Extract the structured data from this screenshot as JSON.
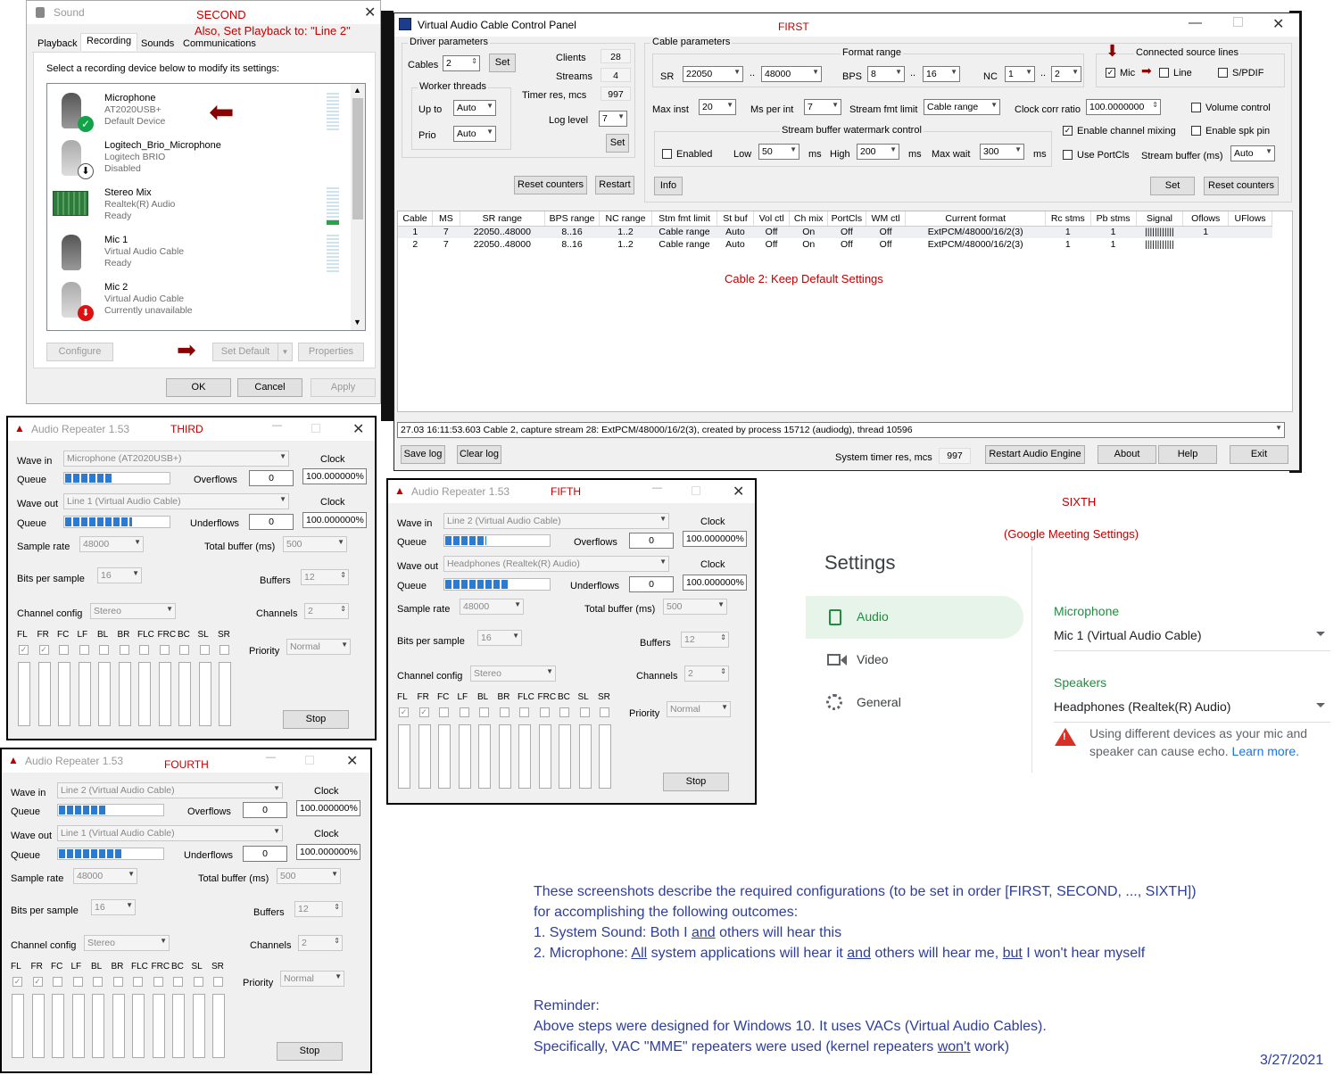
{
  "sound": {
    "title": "Sound",
    "tag": "SECOND",
    "tag2": "Also, Set Playback to:  \"Line 2\"",
    "tabs": [
      "Playback",
      "Recording",
      "Sounds",
      "Communications"
    ],
    "instruction": "Select a recording device below to modify its settings:",
    "devices": [
      {
        "name": "Microphone",
        "sub1": "AT2020USB+",
        "sub2": "Default Device"
      },
      {
        "name": "Logitech_Brio_Microphone",
        "sub1": "Logitech BRIO",
        "sub2": "Disabled"
      },
      {
        "name": "Stereo Mix",
        "sub1": "Realtek(R) Audio",
        "sub2": "Ready"
      },
      {
        "name": "Mic 1",
        "sub1": "Virtual Audio Cable",
        "sub2": "Ready"
      },
      {
        "name": "Mic 2",
        "sub1": "Virtual Audio Cable",
        "sub2": "Currently unavailable"
      }
    ],
    "configure": "Configure",
    "set_default": "Set Default",
    "properties": "Properties",
    "ok": "OK",
    "cancel": "Cancel",
    "apply": "Apply"
  },
  "vac": {
    "title": "Virtual Audio Cable Control Panel",
    "tag": "FIRST",
    "driver_params": "Driver parameters",
    "cables_lbl": "Cables",
    "cables_val": "2",
    "set": "Set",
    "clients_lbl": "Clients",
    "clients_val": "28",
    "streams_lbl": "Streams",
    "streams_val": "4",
    "timer_lbl": "Timer res, mcs",
    "timer_val": "997",
    "worker": "Worker threads",
    "upto_lbl": "Up to",
    "upto_val": "Auto",
    "prio_lbl": "Prio",
    "prio_val": "Auto",
    "loglevel_lbl": "Log level",
    "loglevel_val": "7",
    "reset_counters": "Reset counters",
    "restart": "Restart",
    "cable_params": "Cable parameters",
    "format_range": "Format range",
    "sr_lbl": "SR",
    "sr_from": "22050",
    "sr_to": "48000",
    "dots": "..",
    "bps_lbl": "BPS",
    "bps_from": "8",
    "bps_to": "16",
    "nc_lbl": "NC",
    "nc_from": "1",
    "nc_to": "2",
    "connected": "Connected source lines",
    "mic": "Mic",
    "line": "Line",
    "spdif": "S/PDIF",
    "maxinst_lbl": "Max inst",
    "maxinst_val": "20",
    "msperint_lbl": "Ms per int",
    "msperint_val": "7",
    "stmfmt_lbl": "Stream fmt limit",
    "stmfmt_val": "Cable range",
    "clockcorr_lbl": "Clock corr ratio",
    "clockcorr_val": "100.0000000",
    "volume_control": "Volume control",
    "watermark": "Stream buffer watermark control",
    "enabled": "Enabled",
    "low_lbl": "Low",
    "low_val": "50",
    "ms": "ms",
    "high_lbl": "High",
    "high_val": "200",
    "maxwait_lbl": "Max wait",
    "maxwait_val": "300",
    "enable_channel_mixing": "Enable channel mixing",
    "enable_spk_pin": "Enable spk pin",
    "use_portcls": "Use PortCls",
    "stream_buffer_lbl": "Stream buffer (ms)",
    "stream_buffer_val": "Auto",
    "info": "Info",
    "set2": "Set",
    "reset_counters2": "Reset counters",
    "table": {
      "headers": [
        "Cable",
        "MS",
        "SR range",
        "BPS range",
        "NC range",
        "Stm fmt limit",
        "St buf",
        "Vol ctl",
        "Ch mix",
        "PortCls",
        "WM ctl",
        "Current format",
        "Rc stms",
        "Pb stms",
        "Signal",
        "Oflows",
        "UFlows"
      ],
      "rows": [
        [
          "1",
          "7",
          "22050..48000",
          "8..16",
          "1..2",
          "Cable range",
          "Auto",
          "Off",
          "On",
          "Off",
          "Off",
          "ExtPCM/48000/16/2(3)",
          "1",
          "1",
          "||||||||||||",
          "1",
          ""
        ],
        [
          "2",
          "7",
          "22050..48000",
          "8..16",
          "1..2",
          "Cable range",
          "Auto",
          "Off",
          "On",
          "Off",
          "Off",
          "ExtPCM/48000/16/2(3)",
          "1",
          "1",
          "||||||||||||",
          "",
          ""
        ]
      ]
    },
    "note": "Cable 2:  Keep Default Settings",
    "log": "27.03 16:11:53.603 Cable 2, capture stream 28: ExtPCM/48000/16/2(3), created by process 15712 (audiodg), thread 10596",
    "save_log": "Save log",
    "clear_log": "Clear log",
    "systimer_lbl": "System timer res, mcs",
    "systimer_val": "997",
    "restart_engine": "Restart Audio Engine",
    "about": "About",
    "help": "Help",
    "exit": "Exit"
  },
  "repeaters": [
    {
      "title": "Audio Repeater 1.53",
      "tag": "THIRD",
      "wave_in": "Microphone (AT2020USB+)",
      "wave_out": "Line 1 (Virtual Audio Cable)",
      "clock1": "100.000000%",
      "clock2": "100.000000%",
      "overflows": "0",
      "underflows": "0",
      "queue_in": 0.45,
      "queue_out": 0.65
    },
    {
      "title": "Audio Repeater 1.53",
      "tag": "FOURTH",
      "wave_in": "Line 2 (Virtual Audio Cable)",
      "wave_out": "Line 1 (Virtual Audio Cable)",
      "clock1": "100.000000%",
      "clock2": "100.000000%",
      "overflows": "0",
      "underflows": "0",
      "queue_in": 0.45,
      "queue_out": 0.6
    },
    {
      "title": "Audio Repeater 1.53",
      "tag": "FIFTH",
      "wave_in": "Line 2 (Virtual Audio Cable)",
      "wave_out": "Headphones (Realtek(R) Audio)",
      "clock1": "100.000000%",
      "clock2": "100.000000%",
      "overflows": "0",
      "underflows": "0",
      "queue_in": 0.4,
      "queue_out": 0.6
    }
  ],
  "rep_common": {
    "wave_in_lbl": "Wave in",
    "wave_out_lbl": "Wave out",
    "queue_lbl": "Queue",
    "overflows_lbl": "Overflows",
    "underflows_lbl": "Underflows",
    "clock_lbl": "Clock",
    "sample_rate_lbl": "Sample rate",
    "sample_rate": "48000",
    "total_buffer_lbl": "Total buffer (ms)",
    "total_buffer": "500",
    "bits_lbl": "Bits per sample",
    "bits": "16",
    "buffers_lbl": "Buffers",
    "buffers": "12",
    "chcfg_lbl": "Channel config",
    "chcfg": "Stereo",
    "channels_lbl": "Channels",
    "channels": "2",
    "priority_lbl": "Priority",
    "priority": "Normal",
    "stop": "Stop",
    "ch_labels": [
      "FL",
      "FR",
      "FC",
      "LF",
      "BL",
      "BR",
      "FLC",
      "FRC",
      "BC",
      "SL",
      "SR"
    ],
    "ch_checked": [
      true,
      true,
      false,
      false,
      false,
      false,
      false,
      false,
      false,
      false,
      false
    ]
  },
  "meet": {
    "tag": "SIXTH",
    "subtitle": "(Google Meeting Settings)",
    "settings": "Settings",
    "audio": "Audio",
    "video": "Video",
    "general": "General",
    "mic_lbl": "Microphone",
    "mic_val": "Mic 1 (Virtual Audio Cable)",
    "spk_lbl": "Speakers",
    "spk_val": "Headphones (Realtek(R) Audio)",
    "warning": "Using different devices as your mic and speaker can cause echo.",
    "learn_more": "Learn more."
  },
  "notes": {
    "l1": "These screenshots describe the required configurations (to be set in order [FIRST, SECOND, ..., SIXTH])",
    "l2": "for accomplishing the following outcomes:",
    "l3a": "1.  System Sound:  Both I ",
    "l3b": "and",
    "l3c": " others will hear this",
    "l4a": "2.  Microphone:  ",
    "l4b": "All",
    "l4c": " system applications will hear it ",
    "l4d": "and",
    "l4e": " others will hear me, ",
    "l4f": "but",
    "l4g": " I won't hear myself",
    "r1": "Reminder:",
    "r2": "Above steps were designed for Windows 10.  It uses VACs (Virtual Audio Cables).",
    "r3a": "Specifically, VAC \"MME\" repeaters were used (kernel repeaters ",
    "r3b": "won't",
    "r3c": " work)",
    "date": "3/27/2021"
  },
  "colors": {
    "accent_green": "#1e8e3e",
    "meet_selected": "#e6f4ea",
    "notes_blue": "#2e3e9b",
    "tag_red": "#c00000",
    "queue_blue": "#2b7bd1"
  }
}
